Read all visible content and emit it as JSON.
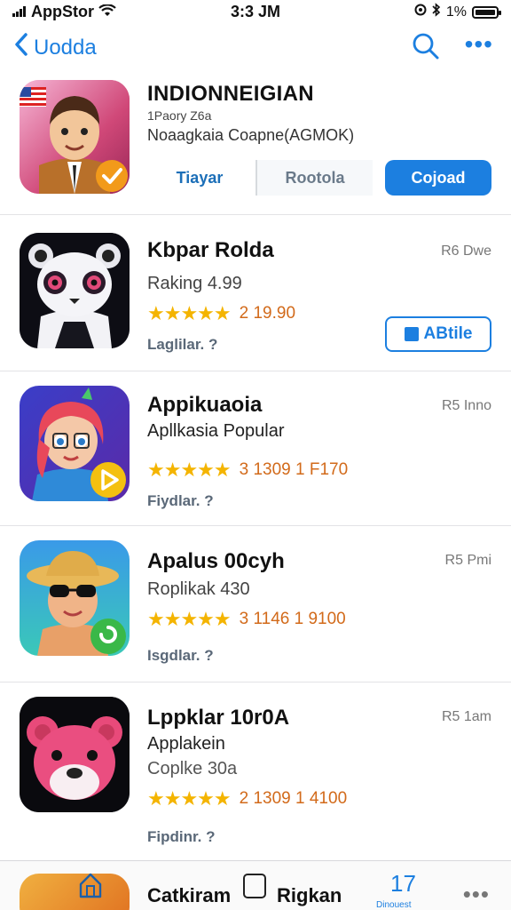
{
  "status_bar": {
    "carrier": "AppStor",
    "time": "3:3 JM",
    "battery_percent": "1%"
  },
  "nav": {
    "back_label": "Uodda"
  },
  "featured": {
    "title": "INDIONNEIGIAN",
    "subtitle_small": "1Paory Z6a",
    "subtitle": "Noaagkaia Coapne(AGMOK)",
    "segments": [
      "Tiayar",
      "Rootola",
      "Cojoad"
    ]
  },
  "apps": [
    {
      "title": "Kbpar Rolda",
      "subtitle": "Raking 4.99",
      "stars": "★★★★★",
      "rating": "2 19.90",
      "link": "Laglilar. ?",
      "size": "R6 Dwe",
      "button": "ABtile"
    },
    {
      "title": "Appikuaoia",
      "subtitle": "Apllkasia Popular",
      "stars": "★★★★★",
      "rating": "3 1309 1 F170",
      "link": "Fiydlar. ?",
      "size": "R5 Inno"
    },
    {
      "title": "Apalus 00cyh",
      "subtitle": "Roplikak 430",
      "stars": "★★★★★",
      "rating": "3 1146 1 9100",
      "link": "Isgdlar. ?",
      "size": "R5 Pmi"
    },
    {
      "title": "Lppklar 10r0A",
      "subtitle": "Applakein",
      "subtitle2": "Coplke 30a",
      "stars": "★★★★★",
      "rating": "2 1309 1 4100",
      "link": "Fipdinr. ?",
      "size": "R5 1am"
    }
  ],
  "tab_bar": {
    "label_1": "Catkiram",
    "label_2": "Rigkan",
    "badge_number": "17",
    "badge_label": "Dinouest"
  },
  "colors": {
    "accent": "#1c7fe0",
    "star": "#f4b400",
    "rating_text": "#d26a1a"
  }
}
